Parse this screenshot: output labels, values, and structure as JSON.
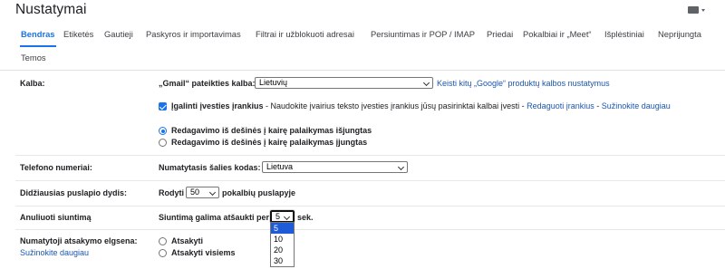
{
  "header": {
    "title": "Nustatymai"
  },
  "tabs": {
    "row1": [
      {
        "label": "Bendras",
        "active": true
      },
      {
        "label": "Etiketės"
      },
      {
        "label": "Gautieji"
      },
      {
        "label": "Paskyros ir importavimas"
      },
      {
        "label": "Filtrai ir užblokuoti adresai"
      },
      {
        "label": "Persiuntimas ir POP / IMAP"
      },
      {
        "label": "Priedai"
      },
      {
        "label": "Pokalbiai ir „Meet“"
      },
      {
        "label": "Išplėstiniai"
      },
      {
        "label": "Neprijungta"
      }
    ],
    "row2": [
      {
        "label": "Temos"
      }
    ]
  },
  "language": {
    "label": "Kalba:",
    "display_label": "„Gmail“ pateikties kalba:",
    "display_value": "Lietuvių",
    "other_products_link": "Keisti kitų „Google“ produktų kalbos nustatymus",
    "input_tools_checked": true,
    "input_tools_label": "Įgalinti įvesties įrankius",
    "input_tools_desc": " - Naudokite įvairius teksto įvesties įrankius jūsų pasirinktai kalbai įvesti - ",
    "edit_tools_link": "Redaguoti įrankius",
    "separator": " - ",
    "learn_more_link": "Sužinokite daugiau",
    "rtl_off_label": "Redagavimo iš dešinės į kairę palaikymas išjungtas",
    "rtl_on_label": "Redagavimo iš dešinės į kairę palaikymas įjungtas",
    "rtl_selected": "off"
  },
  "phone": {
    "label": "Telefono numeriai:",
    "country_code_label": "Numatytasis šalies kodas:",
    "country_value": "Lietuva"
  },
  "page_size": {
    "label": "Didžiausias puslapio dydis:",
    "show_label": "Rodyti",
    "value": "50",
    "suffix": "pokalbių puslapyje"
  },
  "undo_send": {
    "label": "Anuliuoti siuntimą",
    "prefix": "Siuntimą galima atšaukti per",
    "value": "5",
    "suffix": "sek.",
    "options": [
      "5",
      "10",
      "20",
      "30"
    ],
    "selected_index": 0
  },
  "reply_behavior": {
    "label": "Numatytoji atsakymo elgsena:",
    "learn_more_link": "Sužinokite daugiau",
    "reply_label": "Atsakyti",
    "reply_all_label": "Atsakyti visiems"
  }
}
